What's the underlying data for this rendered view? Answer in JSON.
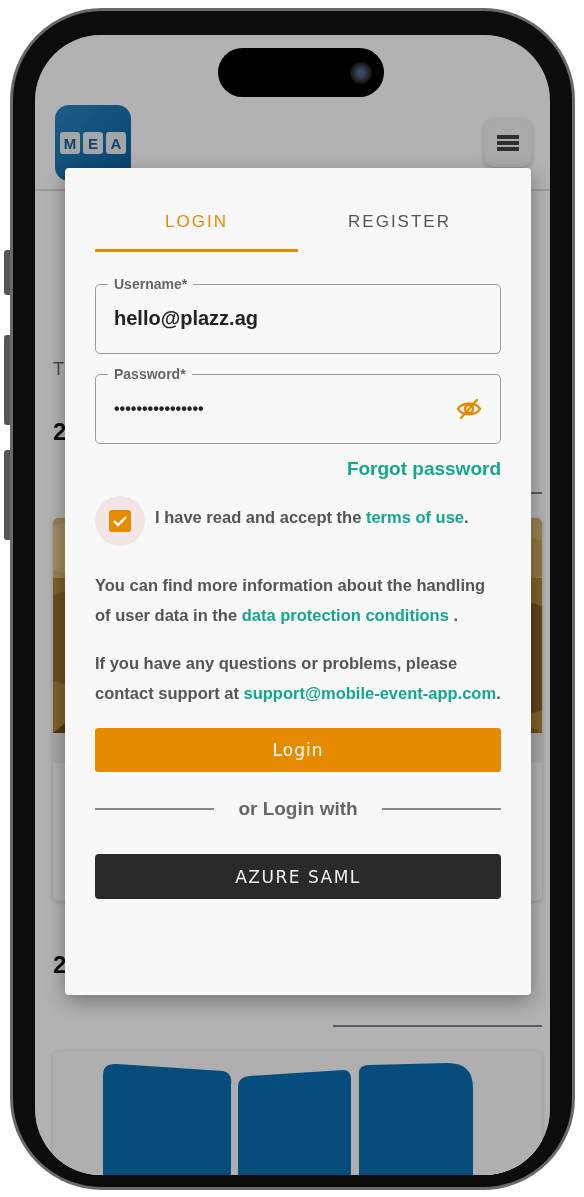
{
  "page": {
    "logo_letters": [
      "M",
      "E",
      "A"
    ],
    "intro_text": "T",
    "sections": [
      {
        "date": "2"
      },
      {
        "date": "2",
        "card": {
          "kind": "logo"
        }
      }
    ]
  },
  "login_dialog": {
    "tabs": [
      {
        "label": "LOGIN",
        "selected": true
      },
      {
        "label": "REGISTER",
        "selected": false
      }
    ],
    "fields": [
      {
        "kind": "text",
        "label": "Username*",
        "value": "hello@plazz.ag"
      },
      {
        "kind": "password",
        "label": "Password*",
        "value": "••••••••••••••••"
      }
    ],
    "forgot_link": "Forgot password",
    "terms": {
      "checked": true,
      "before": "I have read and accept the ",
      "link": "terms of use",
      "after": "."
    },
    "info": [
      {
        "before": "You can find more information about the handling of user data in the ",
        "link": "data protection conditions",
        "after": " ."
      },
      {
        "before": "If you have any questions or problems, please contact support at ",
        "link": "support@mobile-event-app.com",
        "after": "."
      }
    ],
    "login_button": "Login",
    "divider_text": "or Login with",
    "sso_buttons": [
      "AZURE SAML"
    ]
  }
}
